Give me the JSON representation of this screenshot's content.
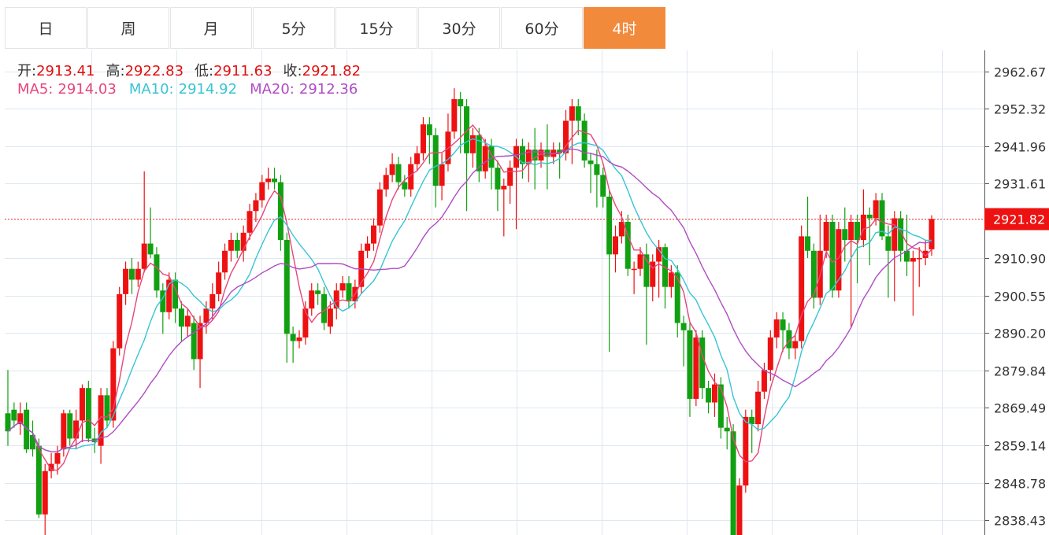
{
  "tabs": [
    {
      "label": "日"
    },
    {
      "label": "周"
    },
    {
      "label": "月"
    },
    {
      "label": "5分"
    },
    {
      "label": "15分"
    },
    {
      "label": "30分"
    },
    {
      "label": "60分"
    },
    {
      "label": "4时",
      "active": true
    }
  ],
  "ohlc": {
    "open_label": "开:",
    "open": "2913.41",
    "high_label": "高:",
    "high": "2922.83",
    "low_label": "低:",
    "low": "2911.63",
    "close_label": "收:",
    "close": "2921.82"
  },
  "ma": {
    "ma5_label": "MA5:",
    "ma5": "2914.03",
    "ma10_label": "MA10:",
    "ma10": "2914.92",
    "ma20_label": "MA20:",
    "ma20": "2912.36"
  },
  "colors": {
    "up": "#ee1111",
    "down": "#11a011",
    "ma5": "#e8457a",
    "ma10": "#39c4d4",
    "ma20": "#b04cc3",
    "active_tab": "#f28a3c",
    "grid": "#dde8f0",
    "price_line": "#e83030"
  },
  "chart_data": {
    "type": "candlestick",
    "y_ticks": [
      2962.67,
      2952.32,
      2941.96,
      2931.61,
      2921.82,
      2910.9,
      2900.55,
      2890.2,
      2879.84,
      2869.49,
      2859.14,
      2848.78,
      2838.43
    ],
    "current_price": 2921.82,
    "ylim": [
      2834.3,
      2968.5
    ],
    "candles": [
      [
        2868,
        2863,
        2880,
        2859
      ],
      [
        2869,
        2866,
        2871,
        2864
      ],
      [
        2865,
        2868,
        2871,
        2862
      ],
      [
        2869,
        2858,
        2871,
        2857
      ],
      [
        2862,
        2858,
        2866,
        2856
      ],
      [
        2859,
        2840,
        2861,
        2839
      ],
      [
        2840,
        2852,
        2854,
        2833
      ],
      [
        2852,
        2854,
        2857,
        2850
      ],
      [
        2854,
        2857,
        2859,
        2851
      ],
      [
        2858,
        2868,
        2869,
        2856
      ],
      [
        2868,
        2861,
        2869,
        2859
      ],
      [
        2861,
        2866,
        2869,
        2858
      ],
      [
        2866,
        2875,
        2876,
        2860
      ],
      [
        2875,
        2861,
        2877,
        2860
      ],
      [
        2861,
        2860,
        2864,
        2857
      ],
      [
        2859,
        2873,
        2875,
        2854
      ],
      [
        2873,
        2866,
        2875,
        2864
      ],
      [
        2866,
        2886,
        2888,
        2864
      ],
      [
        2886,
        2901,
        2903,
        2884
      ],
      [
        2901,
        2908,
        2910,
        2898
      ],
      [
        2908,
        2905,
        2911,
        2901
      ],
      [
        2905,
        2908,
        2910,
        2903
      ],
      [
        2908,
        2915,
        2935,
        2907
      ],
      [
        2915,
        2912,
        2925,
        2911
      ],
      [
        2912,
        2902,
        2914,
        2900
      ],
      [
        2902,
        2896,
        2904,
        2890
      ],
      [
        2896,
        2905,
        2907,
        2894
      ],
      [
        2905,
        2897,
        2907,
        2893
      ],
      [
        2897,
        2892,
        2899,
        2888
      ],
      [
        2892,
        2895,
        2897,
        2889
      ],
      [
        2893,
        2883,
        2895,
        2880
      ],
      [
        2883,
        2893,
        2895,
        2875
      ],
      [
        2893,
        2897,
        2899,
        2890
      ],
      [
        2897,
        2901,
        2904,
        2894
      ],
      [
        2901,
        2907,
        2910,
        2899
      ],
      [
        2907,
        2913,
        2915,
        2905
      ],
      [
        2913,
        2916,
        2918,
        2910
      ],
      [
        2916,
        2913,
        2918,
        2911
      ],
      [
        2913,
        2918,
        2920,
        2910
      ],
      [
        2918,
        2924,
        2926,
        2916
      ],
      [
        2924,
        2927,
        2929,
        2921
      ],
      [
        2927,
        2932,
        2934,
        2925
      ],
      [
        2932,
        2933,
        2936,
        2930
      ],
      [
        2933,
        2932,
        2936,
        2930
      ],
      [
        2932,
        2916,
        2934,
        2913
      ],
      [
        2916,
        2890,
        2918,
        2882
      ],
      [
        2890,
        2888,
        2892,
        2882
      ],
      [
        2888,
        2889,
        2891,
        2886
      ],
      [
        2889,
        2897,
        2899,
        2887
      ],
      [
        2897,
        2902,
        2904,
        2895
      ],
      [
        2902,
        2901,
        2904,
        2898
      ],
      [
        2901,
        2893,
        2903,
        2891
      ],
      [
        2892,
        2897,
        2899,
        2890
      ],
      [
        2897,
        2902,
        2904,
        2894
      ],
      [
        2902,
        2904,
        2906,
        2900
      ],
      [
        2904,
        2899,
        2906,
        2897
      ],
      [
        2899,
        2903,
        2905,
        2897
      ],
      [
        2903,
        2913,
        2915,
        2901
      ],
      [
        2913,
        2915,
        2917,
        2911
      ],
      [
        2915,
        2920,
        2922,
        2913
      ],
      [
        2920,
        2930,
        2932,
        2918
      ],
      [
        2930,
        2934,
        2936,
        2928
      ],
      [
        2934,
        2937,
        2940,
        2932
      ],
      [
        2937,
        2932,
        2939,
        2930
      ],
      [
        2932,
        2930,
        2934,
        2928
      ],
      [
        2930,
        2937,
        2939,
        2928
      ],
      [
        2937,
        2940,
        2942,
        2935
      ],
      [
        2940,
        2948,
        2950,
        2938
      ],
      [
        2948,
        2945,
        2950,
        2937
      ],
      [
        2945,
        2931,
        2947,
        2925
      ],
      [
        2931,
        2937,
        2940,
        2927
      ],
      [
        2937,
        2946,
        2951,
        2935
      ],
      [
        2946,
        2955,
        2958,
        2944
      ],
      [
        2955,
        2953,
        2957,
        2940
      ],
      [
        2953,
        2940,
        2955,
        2924
      ],
      [
        2940,
        2945,
        2947,
        2936
      ],
      [
        2945,
        2935,
        2947,
        2932
      ],
      [
        2935,
        2942,
        2944,
        2933
      ],
      [
        2942,
        2936,
        2944,
        2930
      ],
      [
        2936,
        2930,
        2938,
        2924
      ],
      [
        2930,
        2931,
        2933,
        2917
      ],
      [
        2931,
        2936,
        2938,
        2926
      ],
      [
        2936,
        2942,
        2944,
        2919
      ],
      [
        2942,
        2937,
        2944,
        2933
      ],
      [
        2937,
        2941,
        2943,
        2932
      ],
      [
        2941,
        2938,
        2947,
        2930
      ],
      [
        2938,
        2941,
        2943,
        2936
      ],
      [
        2941,
        2939,
        2948,
        2930
      ],
      [
        2939,
        2941,
        2943,
        2937
      ],
      [
        2941,
        2940,
        2943,
        2933
      ],
      [
        2940,
        2949,
        2952,
        2938
      ],
      [
        2949,
        2953,
        2955,
        2937
      ],
      [
        2953,
        2949,
        2955,
        2945
      ],
      [
        2949,
        2938,
        2951,
        2936
      ],
      [
        2938,
        2937,
        2940,
        2929
      ],
      [
        2937,
        2934,
        2941,
        2925
      ],
      [
        2934,
        2928,
        2936,
        2925
      ],
      [
        2928,
        2912,
        2930,
        2885
      ],
      [
        2912,
        2917,
        2920,
        2907
      ],
      [
        2917,
        2921,
        2924,
        2915
      ],
      [
        2921,
        2908,
        2923,
        2906
      ],
      [
        2908,
        2908,
        2910,
        2901
      ],
      [
        2908,
        2912,
        2914,
        2906
      ],
      [
        2912,
        2903,
        2915,
        2887
      ],
      [
        2903,
        2910,
        2912,
        2899
      ],
      [
        2910,
        2914,
        2916,
        2900
      ],
      [
        2914,
        2903,
        2915,
        2897
      ],
      [
        2903,
        2907,
        2909,
        2900
      ],
      [
        2907,
        2893,
        2909,
        2889
      ],
      [
        2893,
        2891,
        2895,
        2881
      ],
      [
        2891,
        2872,
        2893,
        2867
      ],
      [
        2872,
        2889,
        2891,
        2870
      ],
      [
        2889,
        2875,
        2891,
        2872
      ],
      [
        2875,
        2871,
        2877,
        2868
      ],
      [
        2871,
        2876,
        2879,
        2867
      ],
      [
        2876,
        2864,
        2878,
        2861
      ],
      [
        2864,
        2863,
        2867,
        2858
      ],
      [
        2863,
        2831,
        2865,
        2829
      ],
      [
        2831,
        2848,
        2850,
        2829
      ],
      [
        2848,
        2867,
        2869,
        2846
      ],
      [
        2867,
        2865,
        2869,
        2857
      ],
      [
        2865,
        2874,
        2877,
        2863
      ],
      [
        2874,
        2880,
        2882,
        2872
      ],
      [
        2880,
        2889,
        2891,
        2877
      ],
      [
        2889,
        2894,
        2896,
        2886
      ],
      [
        2894,
        2891,
        2896,
        2885
      ],
      [
        2891,
        2886,
        2893,
        2883
      ],
      [
        2886,
        2888,
        2890,
        2883
      ],
      [
        2888,
        2917,
        2920,
        2886
      ],
      [
        2917,
        2913,
        2928,
        2911
      ],
      [
        2913,
        2900,
        2915,
        2897
      ],
      [
        2900,
        2913,
        2923,
        2898
      ],
      [
        2913,
        2921,
        2923,
        2911
      ],
      [
        2921,
        2902,
        2923,
        2900
      ],
      [
        2902,
        2919,
        2921,
        2900
      ],
      [
        2919,
        2916,
        2925,
        2910
      ],
      [
        2916,
        2921,
        2923,
        2892
      ],
      [
        2921,
        2916,
        2923,
        2904
      ],
      [
        2916,
        2923,
        2930,
        2914
      ],
      [
        2923,
        2922,
        2925,
        2909
      ],
      [
        2922,
        2927,
        2929,
        2920
      ],
      [
        2927,
        2917,
        2929,
        2916
      ],
      [
        2917,
        2913,
        2920,
        2900
      ],
      [
        2913,
        2922,
        2924,
        2899
      ],
      [
        2922,
        2913,
        2924,
        2910
      ],
      [
        2913,
        2910,
        2923,
        2906
      ],
      [
        2910,
        2911,
        2913,
        2895
      ],
      [
        2911,
        2911,
        2914,
        2903
      ],
      [
        2911,
        2913,
        2916,
        2909
      ],
      [
        2913.41,
        2921.82,
        2922.83,
        2911.63
      ]
    ]
  }
}
